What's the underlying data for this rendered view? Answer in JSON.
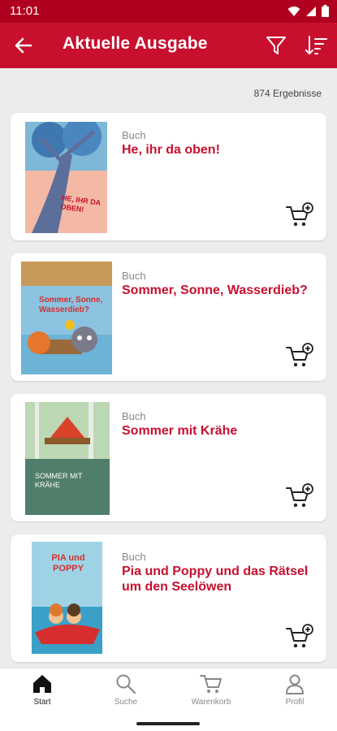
{
  "status_bar": {
    "time": "11:01"
  },
  "header": {
    "title": "Aktuelle Ausgabe"
  },
  "results_count": "874 Ergebnisse",
  "books": [
    {
      "type": "Buch",
      "title": "He, ihr da oben!",
      "cover_text": "HE, IHR DA OBEN!"
    },
    {
      "type": "Buch",
      "title": "Sommer, Sonne, Wasserdieb?",
      "cover_text": "Sommer, Sonne, Wasserdieb?"
    },
    {
      "type": "Buch",
      "title": "Sommer mit Krähe",
      "cover_text": "SOMMER MIT KRÄHE"
    },
    {
      "type": "Buch",
      "title": "Pia und Poppy und das Rätsel um den Seelöwen",
      "cover_text": "PIA und POPPY"
    }
  ],
  "nav": {
    "start": "Start",
    "search": "Suche",
    "cart": "Warenkorb",
    "profile": "Profil"
  },
  "colors": {
    "brand": "#c8102e",
    "status_bar": "#b0001f",
    "background": "#ececec"
  }
}
